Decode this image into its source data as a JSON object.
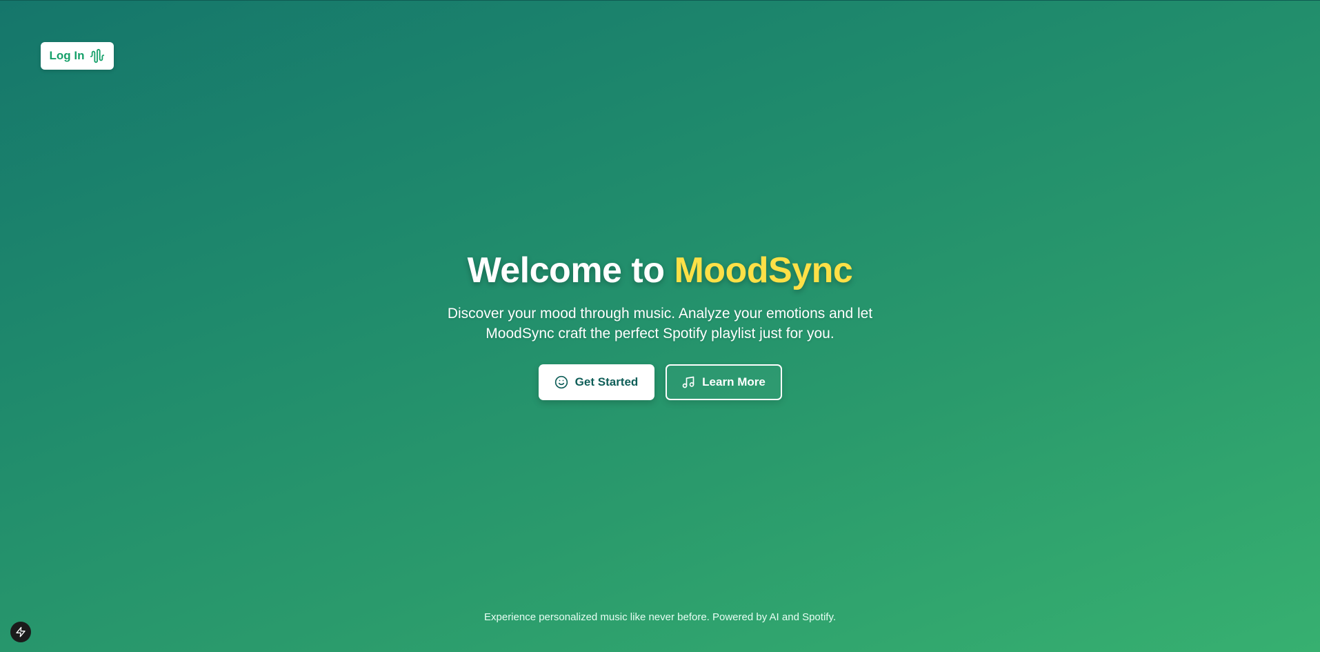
{
  "header": {
    "login_label": "Log In",
    "login_icon": "audio-wave-icon"
  },
  "hero": {
    "title_prefix": "Welcome to ",
    "title_brand": "MoodSync",
    "description": "Discover your mood through music. Analyze your emotions and let MoodSync craft the perfect Spotify playlist just for you.",
    "primary_button": {
      "label": "Get Started",
      "icon": "smile-icon"
    },
    "secondary_button": {
      "label": "Learn More",
      "icon": "music-note-icon"
    }
  },
  "footer": {
    "text": "Experience personalized music like never before. Powered by AI and Spotify."
  },
  "dev_badge": {
    "icon": "lightning-bolt-icon"
  },
  "colors": {
    "brand_accent": "#fde047",
    "login_text": "#16a06a",
    "primary_button_text": "#0f5e58",
    "background_start": "#15766b",
    "background_end": "#37b070"
  }
}
